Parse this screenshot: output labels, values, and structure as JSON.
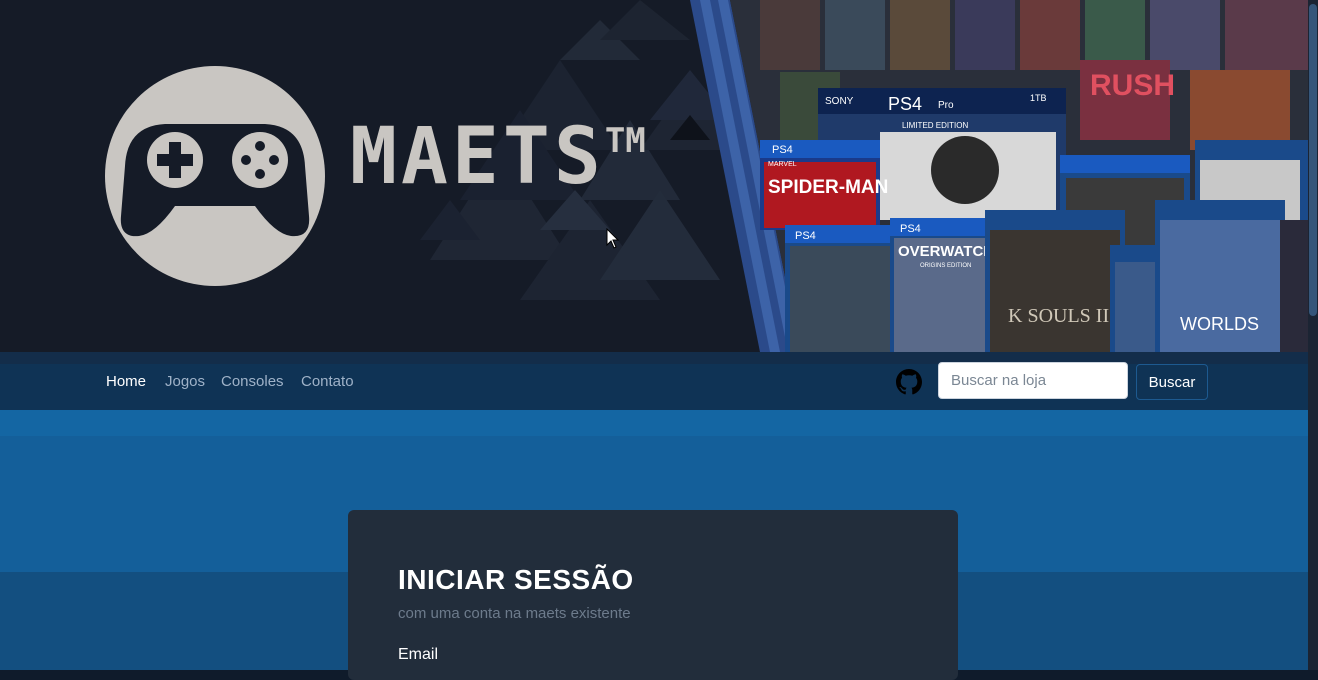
{
  "brand": {
    "logo_text": "MAETS",
    "trademark": "TM"
  },
  "nav": {
    "links": [
      {
        "label": "Home",
        "active": true
      },
      {
        "label": "Jogos",
        "active": false
      },
      {
        "label": "Consoles",
        "active": false
      },
      {
        "label": "Contato",
        "active": false
      }
    ]
  },
  "search": {
    "placeholder": "Buscar na loja",
    "value": "",
    "button_label": "Buscar"
  },
  "login": {
    "title": "INICIAR SESSÃO",
    "subtitle": "com uma conta na maets existente",
    "email_label": "Email"
  },
  "banner_covers": {
    "sony": "SONY",
    "ps4": "PS4",
    "pro": "Pro",
    "storage": "1TB",
    "edition": "LIMITED EDITION",
    "spiderman": "SPIDER-MAN",
    "overwatch": "OVERWATCH",
    "origins": "ORIGINS EDITION",
    "souls": "K SOULS II",
    "worlds": "WORLDS",
    "rush": "RUSH",
    "marvel": "MARVEL"
  },
  "colors": {
    "banner_bg": "#151b27",
    "navbar_bg": "#0f3355",
    "band_blue": "#145f9a",
    "card_bg": "#222d3b",
    "logo_color": "#c9c6c2"
  },
  "icons": {
    "logo": "gamepad-icon",
    "github": "github-icon",
    "cursor": "mouse-pointer-icon"
  }
}
